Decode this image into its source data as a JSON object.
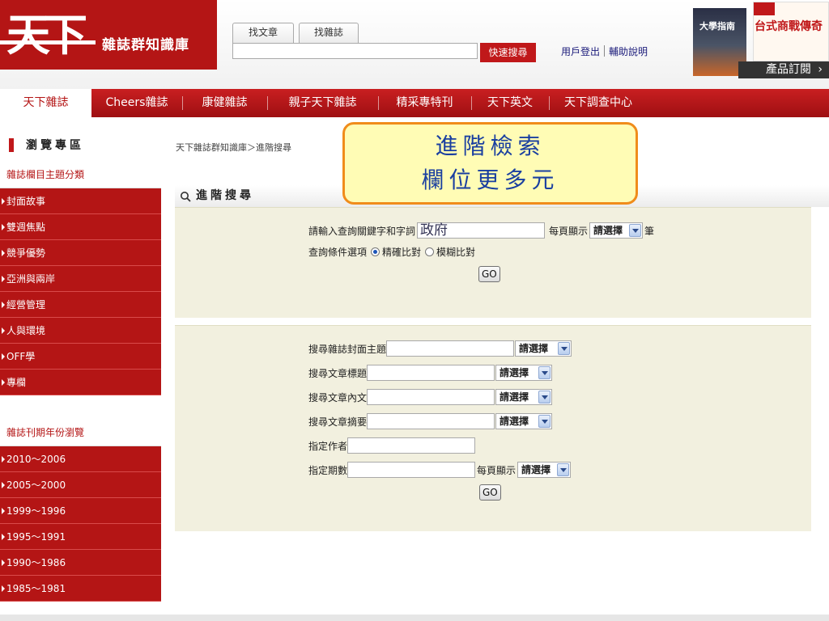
{
  "header": {
    "logo_mark": "天下",
    "logo_text": "雜誌群知識庫",
    "search_tabs": [
      "找文章",
      "找雜誌"
    ],
    "quick_search_label": "快速搜尋",
    "user_links": [
      "用戶登出",
      "輔助說明"
    ],
    "promo": {
      "cover1_text": "大學指南",
      "cover2_text": "台式商戰傳奇",
      "subscribe_label": "產品訂閱"
    }
  },
  "main_nav": {
    "items": [
      "天下雜誌",
      "Cheers雜誌",
      "康健雜誌",
      "親子天下雜誌",
      "精采專特刊",
      "天下英文",
      "天下調查中心"
    ],
    "active": "天下雜誌"
  },
  "sidebar": {
    "browse_title": "瀏覽專區",
    "topic_section_title": "雜誌欄目主題分類",
    "topic_items": [
      "封面故事",
      "雙週焦點",
      "競爭優勢",
      "亞洲與兩岸",
      "經營管理",
      "人與環境",
      "OFF學",
      "專欄"
    ],
    "year_section_title": "雜誌刊期年份瀏覽",
    "year_items": [
      "2010～2006",
      "2005～2000",
      "1999～1996",
      "1995～1991",
      "1990～1986",
      "1985～1981"
    ]
  },
  "content": {
    "breadcrumb": "天下雜誌群知識庫＞進階搜尋",
    "advanced_title": "進階搜尋",
    "panel1": {
      "keyword_label": "請輸入查詢關鍵字和字詞",
      "keyword_value": "政府",
      "per_page_label": "每頁顯示",
      "per_page_select": "請選擇",
      "per_page_unit": "筆",
      "condition_label": "查詢條件選項",
      "exact_label": "精確比對",
      "fuzzy_label": "模糊比對",
      "go_label": "GO"
    },
    "panel2": {
      "cover_topic_label": "搜尋雜誌封面主題",
      "article_title_label": "搜尋文章標題",
      "article_body_label": "搜尋文章內文",
      "article_summary_label": "搜尋文章摘要",
      "author_label": "指定作者",
      "issue_label": "指定期數",
      "select_placeholder": "請選擇",
      "per_page_label": "每頁顯示",
      "go_label": "GO"
    }
  },
  "callout": {
    "line1": "進階檢索",
    "line2": "欄位更多元"
  }
}
